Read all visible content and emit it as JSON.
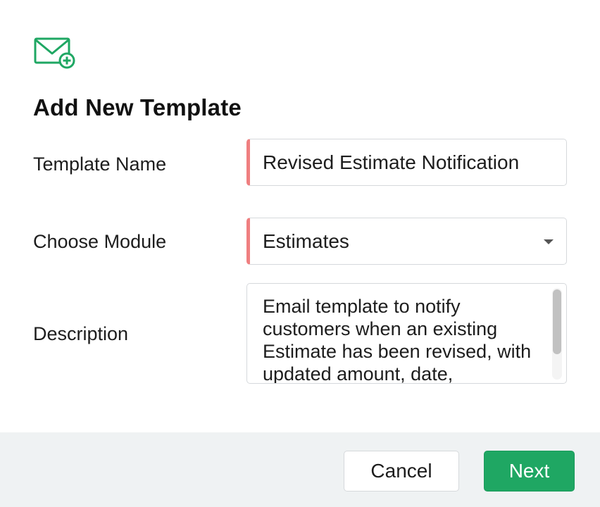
{
  "dialog": {
    "icon": "mail-add-icon",
    "title": "Add New Template",
    "accent_color": "#1fa763",
    "required_marker_color": "#ef7f80"
  },
  "form": {
    "template_name": {
      "label": "Template Name",
      "value": "Revised Estimate Notification"
    },
    "module": {
      "label": "Choose Module",
      "value": "Estimates"
    },
    "description": {
      "label": "Description",
      "value": "Email template to notify customers when an existing Estimate has been revised, with updated amount, date,"
    }
  },
  "footer": {
    "cancel_label": "Cancel",
    "next_label": "Next"
  }
}
